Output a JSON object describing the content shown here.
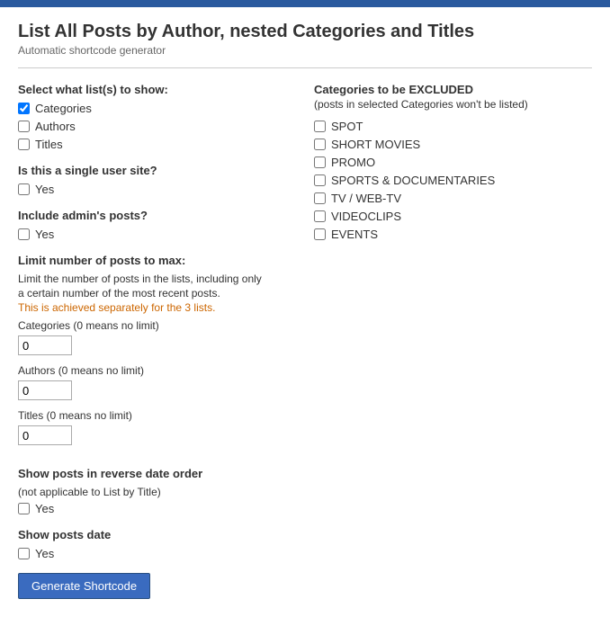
{
  "topBar": {
    "color": "#2a5a9e"
  },
  "header": {
    "title": "List All Posts by Author, nested Categories and Titles",
    "subtitle": "Automatic shortcode generator"
  },
  "leftCol": {
    "selectListLabel": "Select what list(s) to show:",
    "listOptions": [
      {
        "label": "Categories",
        "checked": true
      },
      {
        "label": "Authors",
        "checked": false
      },
      {
        "label": "Titles",
        "checked": false
      }
    ],
    "singleUserLabel": "Is this a single user site?",
    "singleUserYes": "Yes",
    "singleUserChecked": false,
    "includeAdminLabel": "Include admin's posts?",
    "includeAdminYes": "Yes",
    "includeAdminChecked": false,
    "limitLabel": "Limit number of posts to max:",
    "limitInfo1": "Limit the number of posts in the lists, including only",
    "limitInfo2": "a certain number of the most recent posts.",
    "limitInfo3": "This is achieved separately for the 3 lists.",
    "categoriesLimitLabel": "Categories (0 means no limit)",
    "categoriesLimitValue": "0",
    "authorsLimitLabel": "Authors (0 means no limit)",
    "authorsLimitValue": "0",
    "titlesLimitLabel": "Titles (0 means no limit)",
    "titlesLimitValue": "0",
    "reverseOrderLabel": "Show posts in reverse date order",
    "reverseOrderSub": "(not applicable to List by Title)",
    "reverseOrderYes": "Yes",
    "reverseOrderChecked": false,
    "showDateLabel": "Show posts date",
    "showDateYes": "Yes",
    "showDateChecked": false
  },
  "rightCol": {
    "excludeHeader": "Categories to be EXCLUDED",
    "excludeSub": "(posts in selected Categories won't be listed)",
    "categories": [
      {
        "label": "SPOT",
        "checked": false
      },
      {
        "label": "SHORT MOVIES",
        "checked": false
      },
      {
        "label": "PROMO",
        "checked": false
      },
      {
        "label": "SPORTS & DOCUMENTARIES",
        "checked": false
      },
      {
        "label": "TV / WEB-TV",
        "checked": false
      },
      {
        "label": "VIDEOCLIPS",
        "checked": false
      },
      {
        "label": "EVENTS",
        "checked": false
      }
    ]
  },
  "footer": {
    "generateLabel": "Generate Shortcode"
  }
}
